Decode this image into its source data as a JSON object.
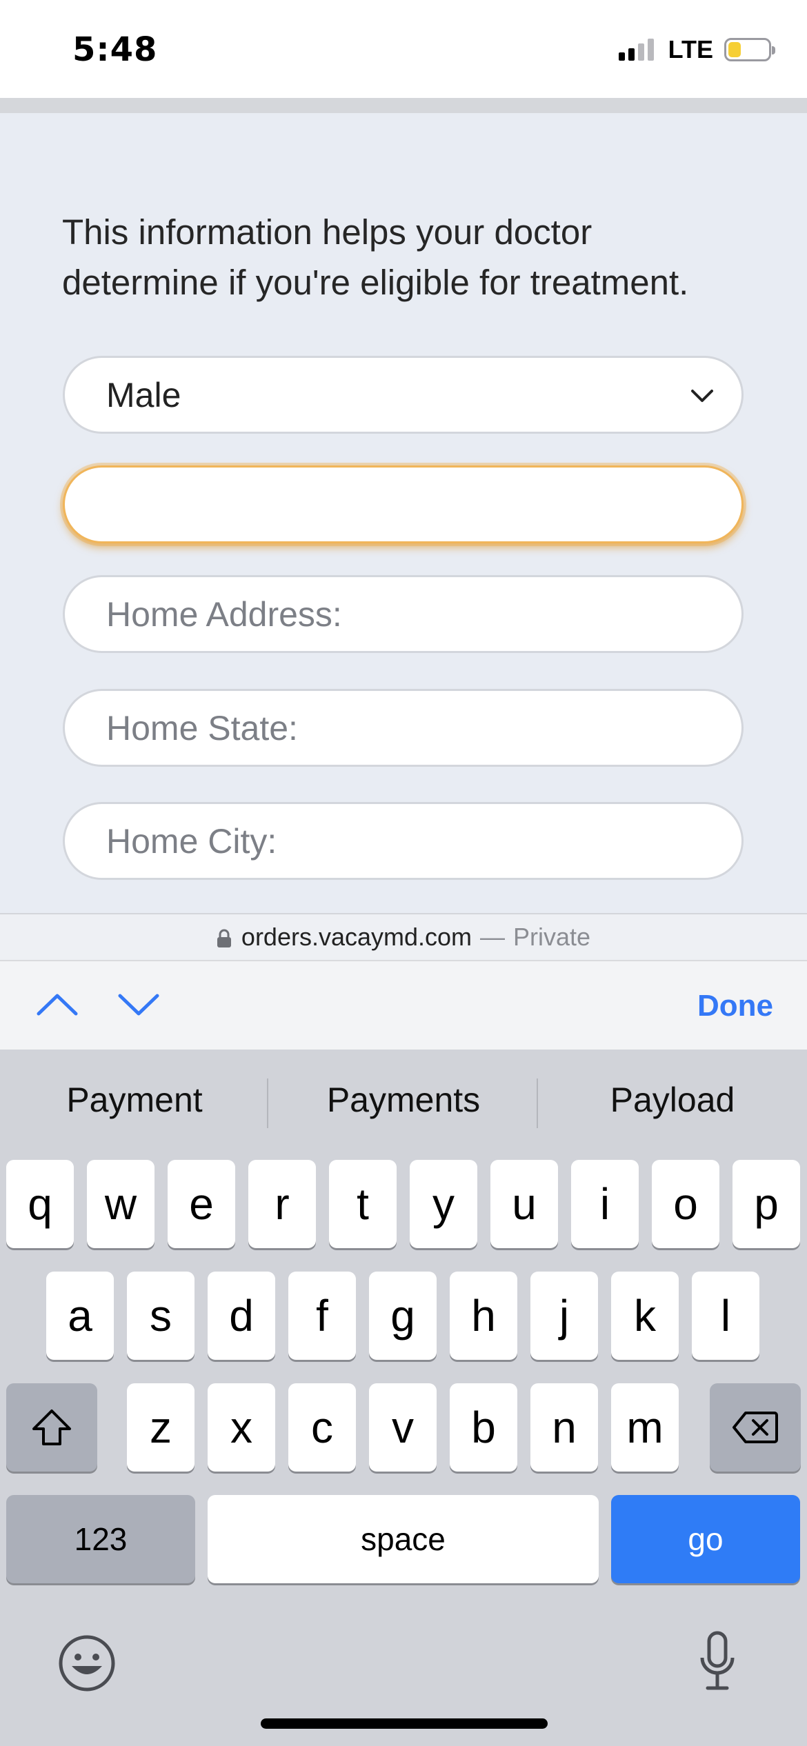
{
  "status_bar": {
    "time": "5:48",
    "network": "LTE",
    "battery_color": "#f6cf35"
  },
  "form": {
    "intro": "This information helps your doctor determine if you're eligible for treatment.",
    "gender_select": {
      "value": "Male"
    },
    "focused_input": {
      "value": ""
    },
    "home_address": {
      "placeholder": "Home Address:"
    },
    "home_state": {
      "placeholder": "Home State:"
    },
    "home_city": {
      "placeholder": "Home City:"
    }
  },
  "url_bar": {
    "host": "orders.vacaymd.com",
    "separator": "—",
    "mode": "Private"
  },
  "accessory": {
    "done_label": "Done"
  },
  "keyboard": {
    "suggestions": [
      "Payment",
      "Payments",
      "Payload"
    ],
    "row1": [
      "q",
      "w",
      "e",
      "r",
      "t",
      "y",
      "u",
      "i",
      "o",
      "p"
    ],
    "row2": [
      "a",
      "s",
      "d",
      "f",
      "g",
      "h",
      "j",
      "k",
      "l"
    ],
    "row3": [
      "z",
      "x",
      "c",
      "v",
      "b",
      "n",
      "m"
    ],
    "numbers_label": "123",
    "space_label": "space",
    "go_label": "go",
    "accent_color": "#2f7cf6"
  }
}
